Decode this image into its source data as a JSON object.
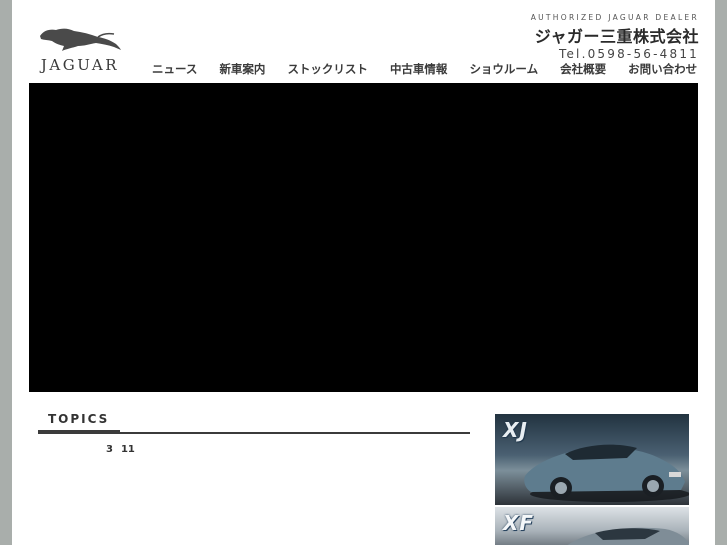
{
  "header": {
    "logo_text": "JAGUAR",
    "dealer_tagline": "AUTHORIZED JAGUAR DEALER",
    "company_name": "ジャガー三重株式会社",
    "phone": "Tel.0598-56-4811"
  },
  "nav": {
    "items": [
      {
        "label": "ニュース"
      },
      {
        "label": "新車案内"
      },
      {
        "label": "ストックリスト"
      },
      {
        "label": "中古車情報"
      },
      {
        "label": "ショウルーム"
      },
      {
        "label": "会社概要"
      },
      {
        "label": "お問い合わせ"
      }
    ]
  },
  "topics": {
    "title": "TOPICS",
    "entry_month": "3",
    "entry_day": "11"
  },
  "banners": {
    "xj_label": "XJ",
    "xf_label": "XF"
  },
  "colors": {
    "page_background": "#a9aeab",
    "hero_background": "#000000",
    "rule_color": "#3b3b3b"
  }
}
